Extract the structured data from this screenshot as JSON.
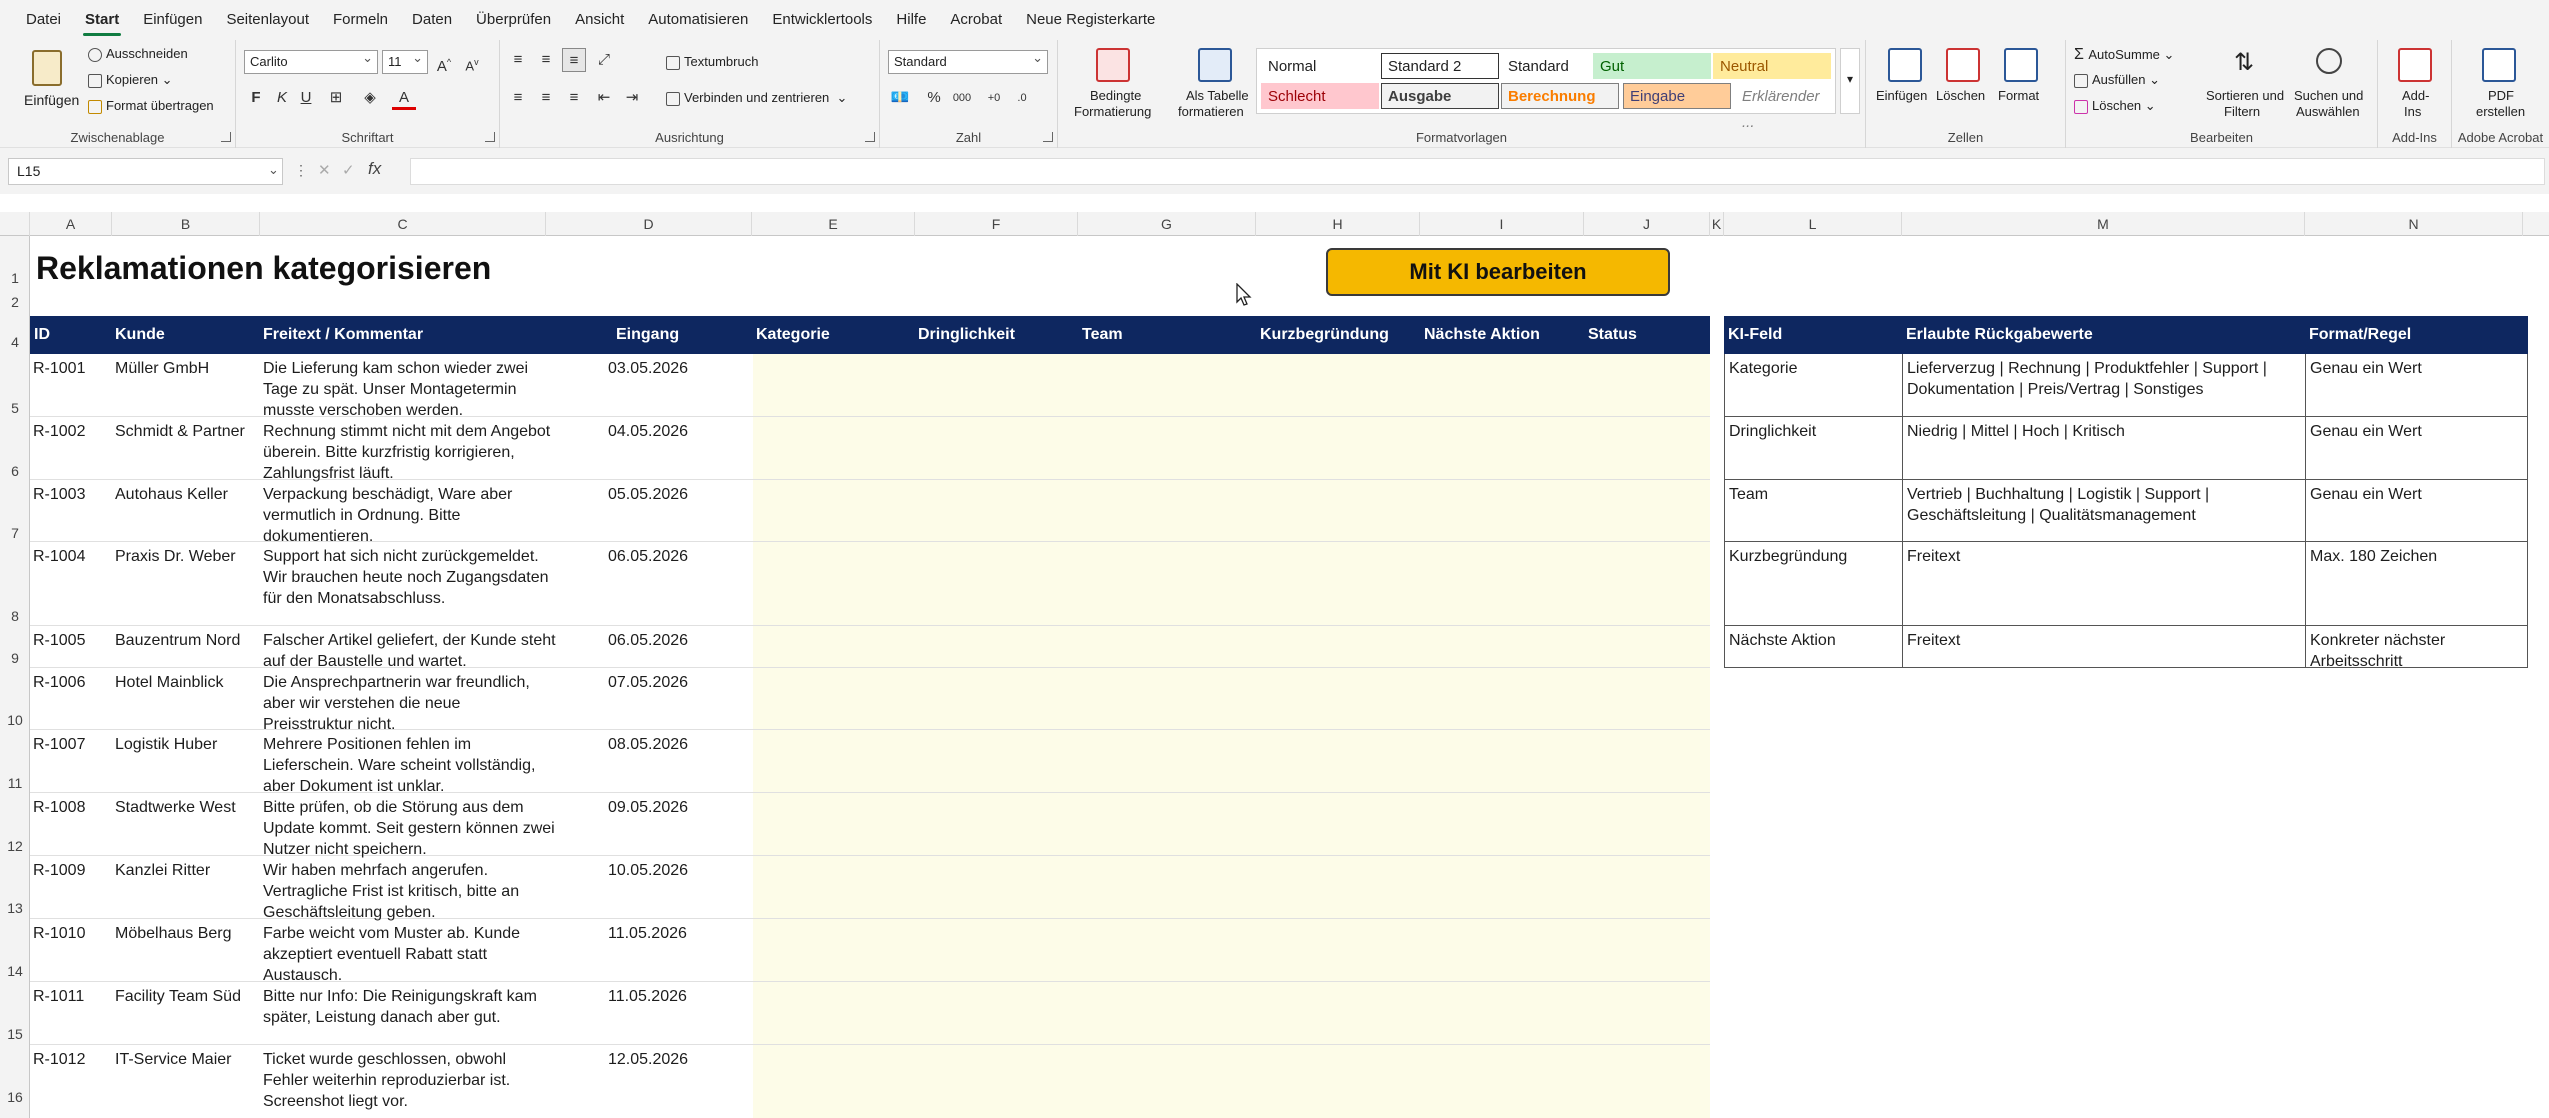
{
  "menu": [
    "Datei",
    "Start",
    "Einfügen",
    "Seitenlayout",
    "Formeln",
    "Daten",
    "Überprüfen",
    "Ansicht",
    "Automatisieren",
    "Entwicklertools",
    "Hilfe",
    "Acrobat",
    "Neue Registerkarte"
  ],
  "ribbon": {
    "clipboard": {
      "paste": "Einfügen",
      "cut": "Ausschneiden",
      "copy": "Kopieren",
      "format_painter": "Format übertragen",
      "label": "Zwischenablage"
    },
    "font": {
      "name": "Carlito",
      "size": "11",
      "label": "Schriftart"
    },
    "alignment": {
      "wrap": "Textumbruch",
      "merge": "Verbinden und zentrieren",
      "label": "Ausrichtung"
    },
    "number": {
      "format": "Standard",
      "label": "Zahl"
    },
    "styles_buttons": {
      "conditional_1": "Bedingte",
      "conditional_2": "Formatierung",
      "table_1": "Als Tabelle",
      "table_2": "formatieren"
    },
    "styles": [
      {
        "label": "Normal",
        "bg": "#ffffff",
        "color": "#000000"
      },
      {
        "label": "Standard 2",
        "bg": "#ffffff",
        "color": "#000000"
      },
      {
        "label": "Standard",
        "bg": "#f3f3f3",
        "color": "#000000"
      },
      {
        "label": "Gut",
        "bg": "#c6efce",
        "color": "#006100"
      },
      {
        "label": "Neutral",
        "bg": "#ffeb9c",
        "color": "#9c5700"
      },
      {
        "label": "Schlecht",
        "bg": "#ffc7ce",
        "color": "#9c0006"
      },
      {
        "label": "Ausgabe",
        "bg": "#f2f2f2",
        "color": "#3f3f3f"
      },
      {
        "label": "Berechnung",
        "bg": "#f2f2f2",
        "color": "#fa7d00"
      },
      {
        "label": "Eingabe",
        "bg": "#ffcc99",
        "color": "#3f3f76"
      },
      {
        "label": "Erklärender ...",
        "bg": "#f3f3f3",
        "color": "#7f7f7f"
      }
    ],
    "styles_label": "Formatvorlagen",
    "cells": {
      "insert": "Einfügen",
      "delete": "Löschen",
      "format": "Format",
      "label": "Zellen"
    },
    "editing": {
      "autosum": "AutoSumme",
      "fill": "Ausfüllen",
      "clear": "Löschen",
      "sort_1": "Sortieren und",
      "sort_2": "Filtern",
      "find_1": "Suchen und",
      "find_2": "Auswählen",
      "label": "Bearbeiten"
    },
    "addins": {
      "b1": "Add-",
      "b2": "Ins",
      "label": "Add-Ins"
    },
    "acrobat": {
      "b1": "PDF",
      "b2": "erstellen",
      "label": "Adobe Acrobat"
    }
  },
  "name_box": "L15",
  "columns": [
    "A",
    "B",
    "C",
    "D",
    "E",
    "F",
    "G",
    "H",
    "I",
    "J",
    "K",
    "L",
    "M",
    "N"
  ],
  "rows": [
    "1",
    "2",
    "4",
    "5",
    "6",
    "7",
    "8",
    "9",
    "10",
    "11",
    "12",
    "13",
    "14",
    "15",
    "16"
  ],
  "title": "Reklamationen kategorisieren",
  "ki_button": "Mit KI bearbeiten",
  "main_headers": [
    "ID",
    "Kunde",
    "Freitext / Kommentar",
    "Eingang",
    "Kategorie",
    "Dringlichkeit",
    "Team",
    "Kurzbegründung",
    "Nächste Aktion",
    "Status"
  ],
  "main_rows": [
    {
      "id": "R-1001",
      "kunde": "Müller GmbH",
      "text": "Die Lieferung kam schon wieder zwei Tage zu spät. Unser Montagetermin musste verschoben werden.",
      "date": "03.05.2026"
    },
    {
      "id": "R-1002",
      "kunde": "Schmidt & Partner",
      "text": "Rechnung stimmt nicht mit dem Angebot überein. Bitte kurzfristig korrigieren, Zahlungsfrist läuft.",
      "date": "04.05.2026"
    },
    {
      "id": "R-1003",
      "kunde": "Autohaus Keller",
      "text": "Verpackung beschädigt, Ware aber vermutlich in Ordnung. Bitte dokumentieren.",
      "date": "05.05.2026"
    },
    {
      "id": "R-1004",
      "kunde": "Praxis Dr. Weber",
      "text": "Support hat sich nicht zurückgemeldet. Wir brauchen heute noch Zugangsdaten für den Monatsabschluss.",
      "date": "06.05.2026"
    },
    {
      "id": "R-1005",
      "kunde": "Bauzentrum Nord",
      "text": "Falscher Artikel geliefert, der Kunde steht auf der Baustelle und wartet.",
      "date": "06.05.2026"
    },
    {
      "id": "R-1006",
      "kunde": "Hotel Mainblick",
      "text": "Die Ansprechpartnerin war freundlich, aber wir verstehen die neue Preisstruktur nicht.",
      "date": "07.05.2026"
    },
    {
      "id": "R-1007",
      "kunde": "Logistik Huber",
      "text": "Mehrere Positionen fehlen im Lieferschein. Ware scheint vollständig, aber Dokument ist unklar.",
      "date": "08.05.2026"
    },
    {
      "id": "R-1008",
      "kunde": "Stadtwerke West",
      "text": "Bitte prüfen, ob die Störung aus dem Update kommt. Seit gestern können zwei Nutzer nicht speichern.",
      "date": "09.05.2026"
    },
    {
      "id": "R-1009",
      "kunde": "Kanzlei Ritter",
      "text": "Wir haben mehrfach angerufen. Vertragliche Frist ist kritisch, bitte an Geschäftsleitung geben.",
      "date": "10.05.2026"
    },
    {
      "id": "R-1010",
      "kunde": "Möbelhaus Berg",
      "text": "Farbe weicht vom Muster ab. Kunde akzeptiert eventuell Rabatt statt Austausch.",
      "date": "11.05.2026"
    },
    {
      "id": "R-1011",
      "kunde": "Facility Team Süd",
      "text": "Bitte nur Info: Die Reinigungskraft kam später, Leistung danach aber gut.",
      "date": "11.05.2026"
    },
    {
      "id": "R-1012",
      "kunde": "IT-Service Maier",
      "text": "Ticket wurde geschlossen, obwohl Fehler weiterhin reproduzierbar ist. Screenshot liegt vor.",
      "date": "12.05.2026"
    }
  ],
  "ki_headers": [
    "KI-Feld",
    "Erlaubte Rückgabewerte",
    "Format/Regel"
  ],
  "ki_rows": [
    {
      "field": "Kategorie",
      "values": "Lieferverzug | Rechnung | Produktfehler | Support | Dokumentation | Preis/Vertrag | Sonstiges",
      "rule": "Genau ein Wert"
    },
    {
      "field": "Dringlichkeit",
      "values": "Niedrig | Mittel | Hoch | Kritisch",
      "rule": "Genau ein Wert"
    },
    {
      "field": "Team",
      "values": "Vertrieb | Buchhaltung | Logistik | Support | Geschäftsleitung | Qualitätsmanagement",
      "rule": "Genau ein Wert"
    },
    {
      "field": "Kurzbegründung",
      "values": "Freitext",
      "rule": "Max. 180 Zeichen"
    },
    {
      "field": "Nächste Aktion",
      "values": "Freitext",
      "rule": "Konkreter nächster Arbeitsschritt"
    }
  ]
}
